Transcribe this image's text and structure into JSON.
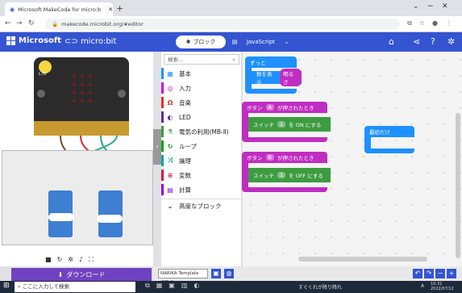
{
  "browser": {
    "tab_title": "Microsoft MakeCode for micro:b",
    "new_tab": "+",
    "url": "makecode.microbit.org/#editor",
    "min": "⌄",
    "restore": "−",
    "maximize": "□",
    "close": "✕"
  },
  "header": {
    "brand": "Microsoft",
    "product": "micro:bit",
    "blocks_label": "ブロック",
    "js_label": "JavaScript"
  },
  "toolbox": {
    "search_placeholder": "検索...",
    "categories": [
      {
        "label": "基本",
        "color": "#1e90ff",
        "icon": "grid-icon"
      },
      {
        "label": "入力",
        "color": "#d400d4",
        "icon": "target-icon"
      },
      {
        "label": "音楽",
        "color": "#e63022",
        "icon": "headphones-icon"
      },
      {
        "label": "LED",
        "color": "#5c2d91",
        "icon": "toggle-icon"
      },
      {
        "label": "電気の利用(MB-Ⅱ)",
        "color": "#3d9c40",
        "icon": "flask-icon"
      },
      {
        "label": "ループ",
        "color": "#00aa00",
        "icon": "loop-icon"
      },
      {
        "label": "論理",
        "color": "#00a4a6",
        "icon": "shuffle-icon"
      },
      {
        "label": "変数",
        "color": "#dc143c",
        "icon": "list-icon"
      },
      {
        "label": "計算",
        "color": "#9400d3",
        "icon": "calculator-icon"
      }
    ],
    "advanced": "高度なブロック"
  },
  "workspace": {
    "forever_label": "ずっと",
    "show_number": "数を表示",
    "brightness": "明るさ",
    "btn_a_header": "ボタン",
    "btn_a_key": "A",
    "pressed": "が押されたとき",
    "switch_label": "スイッチ",
    "switch_num": "1",
    "on_label": "を ON にする",
    "btn_b_key": "B",
    "off_label": "を OFF にする",
    "on_start": "最初だけ"
  },
  "simulator": {
    "download_label": "ダウンロード",
    "light_value": "L76"
  },
  "footer": {
    "project_name": "NARIKA Template (MB-II"
  },
  "taskbar": {
    "search": "ここに入力して検索",
    "weather": "すぐくれが降り降れ",
    "lang": "A",
    "time": "10:31",
    "date": "2022/07/12"
  }
}
